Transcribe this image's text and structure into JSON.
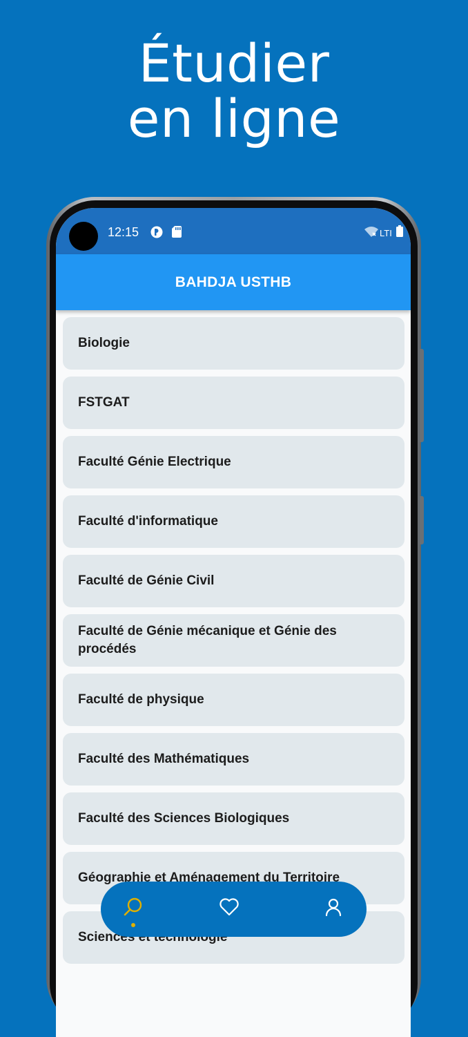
{
  "promo": {
    "headline_line1": "Étudier",
    "headline_line2": "en ligne"
  },
  "status_bar": {
    "time": "12:15",
    "network_label": "LTI",
    "icons": [
      "notification-app-icon",
      "sd-card-icon",
      "wifi-off-icon",
      "battery-icon"
    ]
  },
  "app_bar": {
    "title": "BAHDJA USTHB"
  },
  "faculties": [
    {
      "label": "Biologie"
    },
    {
      "label": "FSTGAT"
    },
    {
      "label": "Faculté Génie Electrique"
    },
    {
      "label": "Faculté d'informatique"
    },
    {
      "label": "Faculté de Génie Civil"
    },
    {
      "label": "Faculté de Génie mécanique et Génie des procédés"
    },
    {
      "label": "Faculté de physique"
    },
    {
      "label": "Faculté des Mathématiques"
    },
    {
      "label": "Faculté des Sciences Biologiques"
    },
    {
      "label": "Géographie et Aménagement du Territoire"
    },
    {
      "label": "Sciences et technologie"
    }
  ],
  "bottom_nav": {
    "items": [
      "search-icon",
      "heart-icon",
      "user-icon"
    ],
    "active": "search-icon"
  },
  "colors": {
    "background": "#0572bd",
    "status_bar": "#1e6fbf",
    "app_bar": "#2196f3",
    "list_item": "#e1e8ec",
    "active_nav": "#e0b000"
  }
}
